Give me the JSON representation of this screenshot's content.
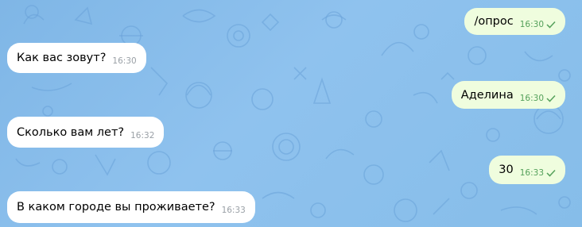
{
  "chat": {
    "messages": [
      {
        "id": "m1",
        "direction": "outgoing",
        "text": "/опрос",
        "time": "16:30",
        "status": "read"
      },
      {
        "id": "m2",
        "direction": "incoming",
        "text": "Как вас зовут?",
        "time": "16:30"
      },
      {
        "id": "m3",
        "direction": "outgoing",
        "text": "Аделина",
        "time": "16:30",
        "status": "read"
      },
      {
        "id": "m4",
        "direction": "incoming",
        "text": "Сколько вам лет?",
        "time": "16:32"
      },
      {
        "id": "m5",
        "direction": "outgoing",
        "text": "30",
        "time": "16:33",
        "status": "read"
      },
      {
        "id": "m6",
        "direction": "incoming",
        "text": "В каком городе вы проживаете?",
        "time": "16:33"
      }
    ]
  },
  "theme": {
    "incoming_bubble": "#ffffff",
    "outgoing_bubble": "#effdde",
    "outgoing_time_color": "#55a15b",
    "background": "#86bde9"
  },
  "icons": {
    "read_status": "check-icon",
    "wallpaper": "space-doodle-pattern"
  }
}
